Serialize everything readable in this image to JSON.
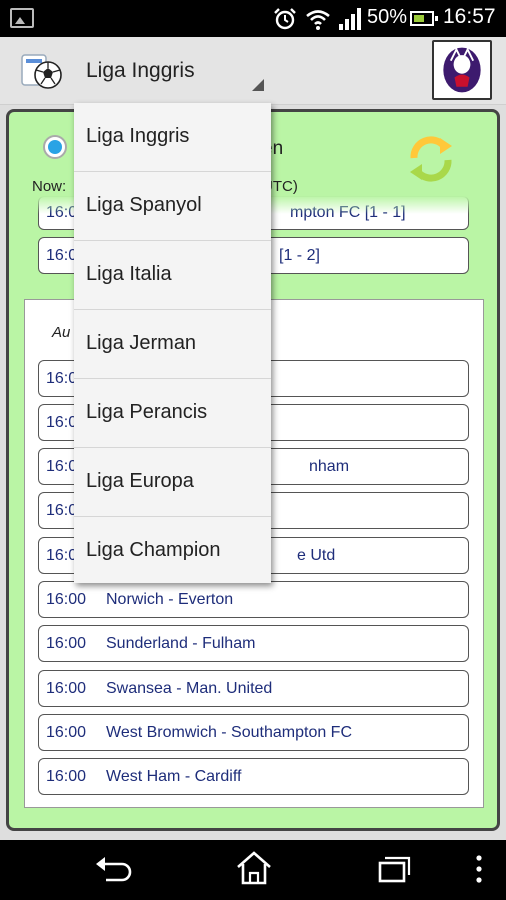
{
  "status_bar": {
    "battery_text": "50%",
    "time": "16:57"
  },
  "action_bar": {
    "selected_league": "Liga Inggris"
  },
  "dropdown": {
    "items": [
      "Liga Inggris",
      "Liga Spanyol",
      "Liga Italia",
      "Liga Jerman",
      "Liga Perancis",
      "Liga Europa",
      "Liga Champion"
    ]
  },
  "top_section": {
    "radio_label_partial": "en",
    "now_label": "Now:",
    "utc_partial": "UTC)",
    "partial_matches": [
      {
        "time": "16:0",
        "teams": "mpton FC   [1 - 1]"
      },
      {
        "time": "16:0",
        "teams": "[1 - 2]"
      }
    ]
  },
  "bottom_section": {
    "date_label_partial": "Au",
    "partial_matches": [
      {
        "time": "16:0",
        "teams": ""
      },
      {
        "time": "16:0",
        "teams": ""
      },
      {
        "time": "16:0",
        "teams": "nham"
      },
      {
        "time": "16:0",
        "teams": ""
      },
      {
        "time": "16:0",
        "teams": "e Utd"
      }
    ],
    "matches": [
      {
        "time": "16:00",
        "teams": "Norwich - Everton"
      },
      {
        "time": "16:00",
        "teams": "Sunderland - Fulham"
      },
      {
        "time": "16:00",
        "teams": "Swansea - Man. United"
      },
      {
        "time": "16:00",
        "teams": "West Bromwich - Southampton FC"
      },
      {
        "time": "16:00",
        "teams": "West Ham - Cardiff"
      }
    ]
  },
  "colors": {
    "panel_green": "#baf5a5",
    "match_text": "#1e2d7a",
    "radio_blue": "#29a3e5",
    "refresh_green": "#a9d84a",
    "refresh_yellow": "#ffc83a"
  },
  "icons": {
    "status": [
      "image-icon",
      "alarm-icon",
      "wifi-icon",
      "signal-icon",
      "battery-icon"
    ],
    "nav": [
      "back-icon",
      "home-icon",
      "recent-apps-icon",
      "overflow-menu-icon"
    ]
  }
}
